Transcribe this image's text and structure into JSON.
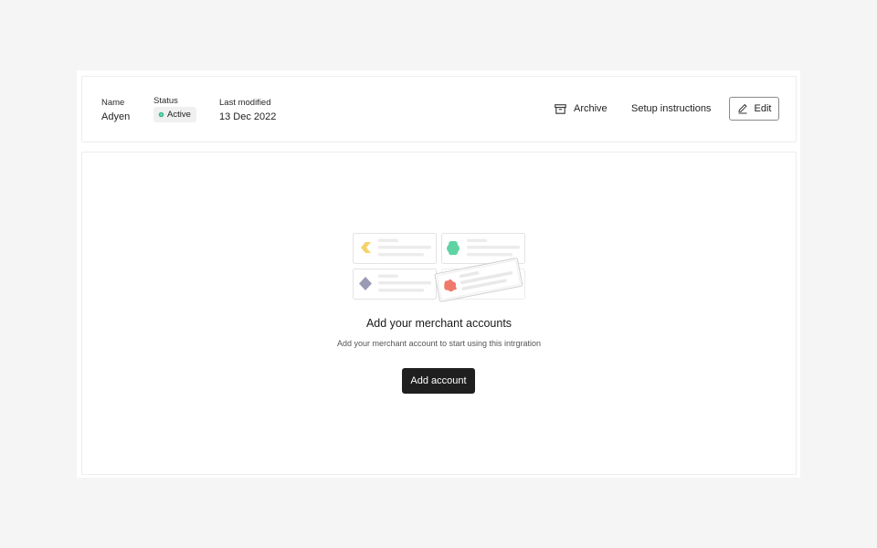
{
  "header": {
    "name_label": "Name",
    "name_value": "Adyen",
    "status_label": "Status",
    "status_value": "Active",
    "status_color": "#3bbf8f",
    "last_modified_label": "Last modified",
    "last_modified_value": "13 Dec 2022",
    "actions": {
      "archive_label": "Archive",
      "archive_icon": "archive-icon",
      "setup_label": "Setup instructions",
      "edit_label": "Edit",
      "edit_icon": "pencil-icon"
    }
  },
  "empty_state": {
    "title": "Add your merchant accounts",
    "subtitle": "Add your merchant account to start using this intrgration",
    "button_label": "Add account",
    "illustration": {
      "cards": [
        {
          "icon": "yellow-shape-icon",
          "color": "#f7d26a"
        },
        {
          "icon": "green-shape-icon",
          "color": "#5fd3a3"
        },
        {
          "icon": "purple-diamond-icon",
          "color": "#9a9ab5"
        },
        {
          "icon": "red-shape-icon",
          "color": "#f07a6a"
        }
      ]
    }
  },
  "colors": {
    "page_bg": "#f5f5f5",
    "primary_button": "#1f1f1f"
  }
}
